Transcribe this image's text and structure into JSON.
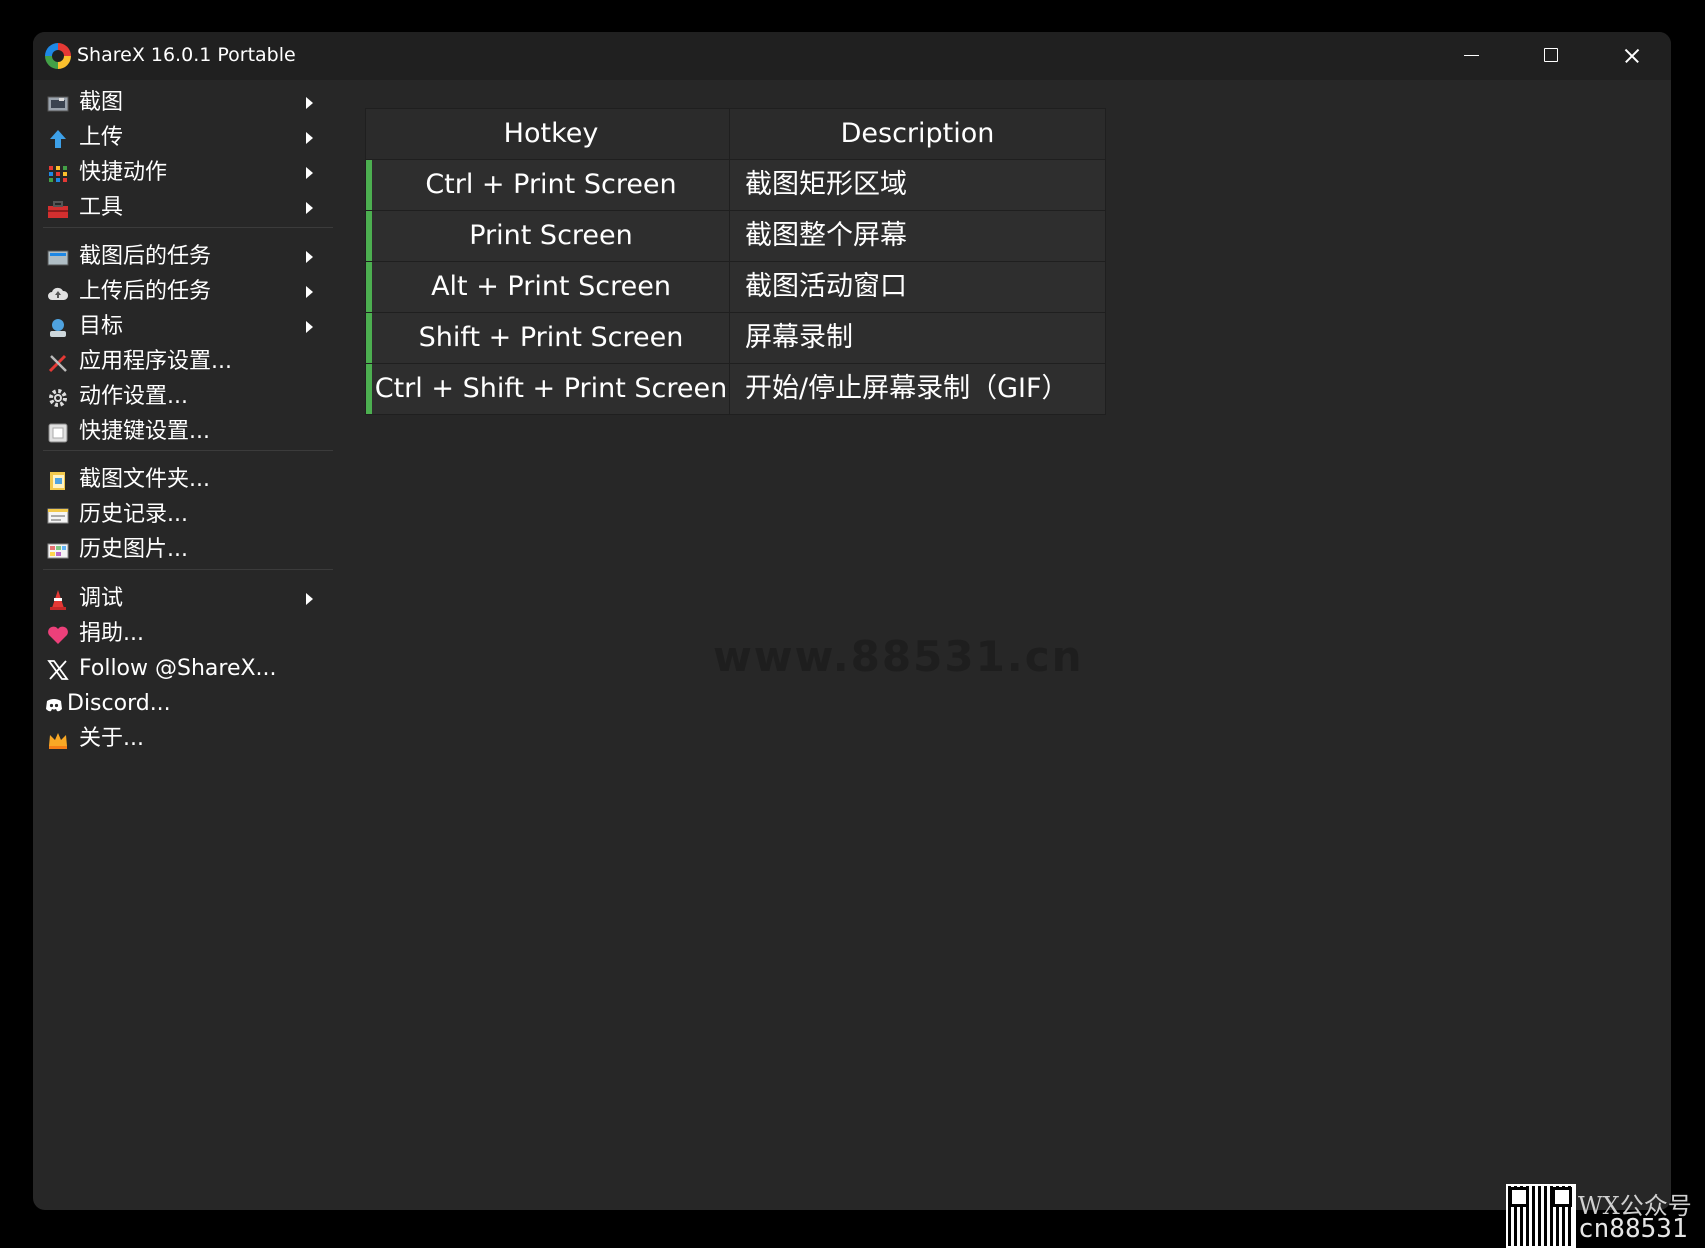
{
  "window": {
    "title": "ShareX 16.0.1 Portable"
  },
  "menu": {
    "groups": [
      [
        {
          "label": "截图",
          "icon": "capture-icon",
          "submenu": true
        },
        {
          "label": "上传",
          "icon": "upload-arrow-icon",
          "submenu": true
        },
        {
          "label": "快捷动作",
          "icon": "grid-dots-icon",
          "submenu": true
        },
        {
          "label": "工具",
          "icon": "toolbox-icon",
          "submenu": true
        }
      ],
      [
        {
          "label": "截图后的任务",
          "icon": "after-capture-icon",
          "submenu": true
        },
        {
          "label": "上传后的任务",
          "icon": "cloud-icon",
          "submenu": true
        },
        {
          "label": "目标",
          "icon": "destination-icon",
          "submenu": true
        },
        {
          "label": "应用程序设置...",
          "icon": "wrench-screwdriver-icon",
          "submenu": false
        },
        {
          "label": "动作设置...",
          "icon": "gear-icon",
          "submenu": false
        },
        {
          "label": "快捷键设置...",
          "icon": "keyboard-key-icon",
          "submenu": false
        }
      ],
      [
        {
          "label": "截图文件夹...",
          "icon": "folder-icon",
          "submenu": false
        },
        {
          "label": "历史记录...",
          "icon": "history-list-icon",
          "submenu": false
        },
        {
          "label": "历史图片...",
          "icon": "image-history-icon",
          "submenu": false
        }
      ],
      [
        {
          "label": "调试",
          "icon": "traffic-cone-icon",
          "submenu": true
        },
        {
          "label": "捐助...",
          "icon": "heart-icon",
          "submenu": false
        },
        {
          "label": "Follow @ShareX...",
          "icon": "x-logo-icon",
          "submenu": false
        },
        {
          "label": "Discord...",
          "icon": "discord-icon",
          "submenu": false
        },
        {
          "label": "关于...",
          "icon": "crown-icon",
          "submenu": false
        }
      ]
    ]
  },
  "hotkeys": {
    "headers": [
      "Hotkey",
      "Description"
    ],
    "rows": [
      {
        "hotkey": "Ctrl + Print Screen",
        "description": "截图矩形区域"
      },
      {
        "hotkey": "Print Screen",
        "description": "截图整个屏幕"
      },
      {
        "hotkey": "Alt + Print Screen",
        "description": "截图活动窗口"
      },
      {
        "hotkey": "Shift + Print Screen",
        "description": "屏幕录制"
      },
      {
        "hotkey": "Ctrl + Shift + Print Screen",
        "description": "开始/停止屏幕录制（GIF）"
      }
    ],
    "status_color": "#4caf50"
  },
  "watermark": "www.88531.cn",
  "corner_badge": {
    "line1": "WX公众号",
    "line2": "cn88531"
  }
}
